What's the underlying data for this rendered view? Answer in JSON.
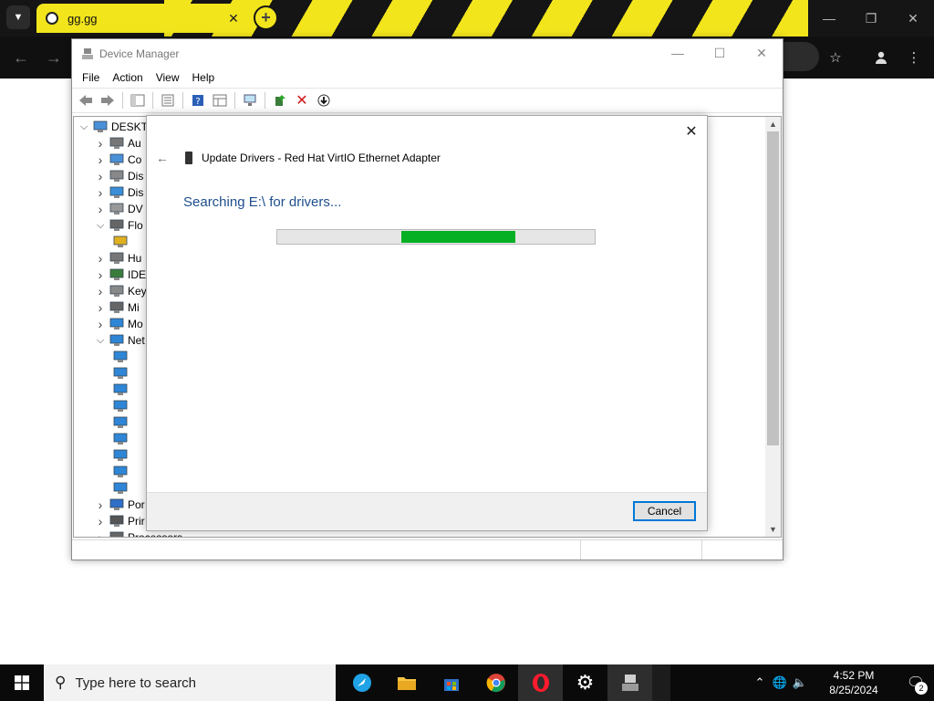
{
  "browser": {
    "tab_title": "gg.gg",
    "colors": {
      "stripe_yellow": "#f2e51c",
      "chrome_dark": "#151515"
    }
  },
  "device_manager": {
    "title": "Device Manager",
    "menu": [
      "File",
      "Action",
      "View",
      "Help"
    ],
    "tree": [
      {
        "label": "DESKTO",
        "icon": "computer-icon",
        "expanded": true
      },
      {
        "label": "Au",
        "icon": "audio-icon"
      },
      {
        "label": "Co",
        "icon": "computer-icon"
      },
      {
        "label": "Dis",
        "icon": "disk-icon"
      },
      {
        "label": "Dis",
        "icon": "display-icon"
      },
      {
        "label": "DV",
        "icon": "dvd-icon"
      },
      {
        "label": "Flo",
        "icon": "floppy-icon",
        "expanded": true
      },
      {
        "label": "",
        "icon": "warning-device-icon"
      },
      {
        "label": "Hu",
        "icon": "hid-icon"
      },
      {
        "label": "IDE",
        "icon": "ide-icon"
      },
      {
        "label": "Key",
        "icon": "keyboard-icon"
      },
      {
        "label": "Mi",
        "icon": "mouse-icon"
      },
      {
        "label": "Mo",
        "icon": "monitor-icon"
      },
      {
        "label": "Net",
        "icon": "network-icon",
        "expanded": true
      },
      {
        "label": "",
        "icon": "network-adapter-icon"
      },
      {
        "label": "",
        "icon": "network-adapter-icon"
      },
      {
        "label": "",
        "icon": "network-adapter-icon"
      },
      {
        "label": "",
        "icon": "network-adapter-icon"
      },
      {
        "label": "",
        "icon": "network-adapter-icon"
      },
      {
        "label": "",
        "icon": "network-adapter-icon"
      },
      {
        "label": "",
        "icon": "network-adapter-icon"
      },
      {
        "label": "",
        "icon": "network-adapter-icon"
      },
      {
        "label": "",
        "icon": "network-adapter-icon"
      },
      {
        "label": "Por",
        "icon": "port-icon"
      },
      {
        "label": "Prir",
        "icon": "printer-icon"
      },
      {
        "label": "Processors",
        "icon": "processor-icon"
      }
    ]
  },
  "dialog": {
    "title": "Update Drivers - Red Hat VirtIO Ethernet Adapter",
    "status": "Searching E:\\ for drivers...",
    "progress_start": 0.39,
    "progress_end": 0.75,
    "cancel_label": "Cancel",
    "colors": {
      "status_text": "#1e4e8c",
      "progress_fill": "#06b025",
      "button_border": "#0078d7"
    }
  },
  "taskbar": {
    "search_placeholder": "Type here to search",
    "time": "4:52 PM",
    "date": "8/25/2024",
    "notification_count": "2"
  }
}
